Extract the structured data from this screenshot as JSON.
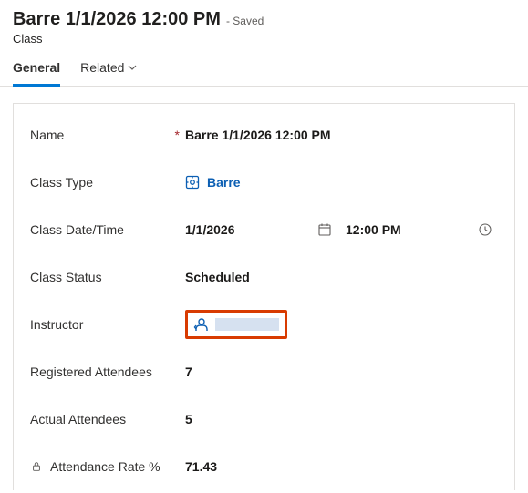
{
  "header": {
    "title": "Barre 1/1/2026 12:00 PM",
    "saved_label": "- Saved",
    "entity_label": "Class"
  },
  "tabs": {
    "general": "General",
    "related": "Related"
  },
  "fields": {
    "name": {
      "label": "Name",
      "value": "Barre 1/1/2026 12:00 PM"
    },
    "class_type": {
      "label": "Class Type",
      "value": "Barre"
    },
    "class_datetime": {
      "label": "Class Date/Time",
      "date": "1/1/2026",
      "time": "12:00 PM"
    },
    "class_status": {
      "label": "Class Status",
      "value": "Scheduled"
    },
    "instructor": {
      "label": "Instructor",
      "value": ""
    },
    "registered": {
      "label": "Registered Attendees",
      "value": "7"
    },
    "actual": {
      "label": "Actual Attendees",
      "value": "5"
    },
    "attendance_rate": {
      "label": "Attendance Rate %",
      "value": "71.43"
    }
  }
}
